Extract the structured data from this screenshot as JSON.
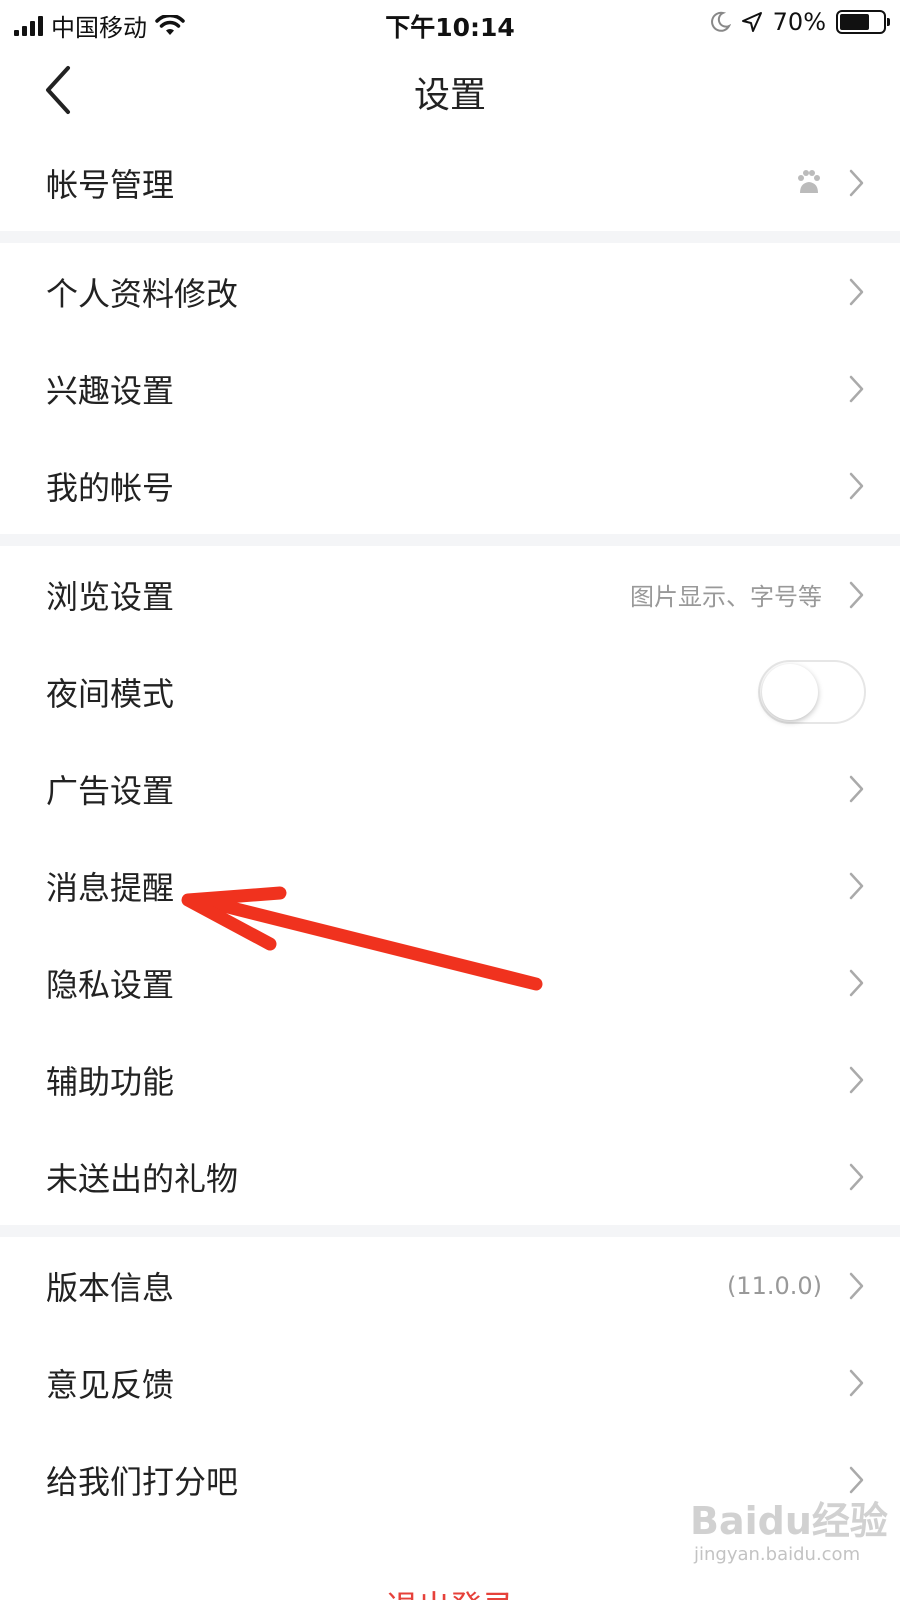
{
  "status_bar": {
    "carrier": "中国移动",
    "time": "下午10:14",
    "battery_text": "70%",
    "battery_level": 0.7
  },
  "nav": {
    "title": "设置",
    "back_icon": "chevron-left-icon"
  },
  "sections": [
    {
      "rows": [
        {
          "id": "account-manage",
          "label": "帐号管理",
          "badge_icon": "baidu-paw-icon"
        }
      ]
    },
    {
      "rows": [
        {
          "id": "profile-edit",
          "label": "个人资料修改"
        },
        {
          "id": "interest",
          "label": "兴趣设置"
        },
        {
          "id": "my-account",
          "label": "我的帐号"
        }
      ]
    },
    {
      "rows": [
        {
          "id": "browse",
          "label": "浏览设置",
          "hint": "图片显示、字号等"
        },
        {
          "id": "night-mode",
          "label": "夜间模式",
          "toggle": false
        },
        {
          "id": "ad",
          "label": "广告设置"
        },
        {
          "id": "notification",
          "label": "消息提醒"
        },
        {
          "id": "privacy",
          "label": "隐私设置"
        },
        {
          "id": "accessibility",
          "label": "辅助功能"
        },
        {
          "id": "unsent-gifts",
          "label": "未送出的礼物"
        }
      ]
    },
    {
      "rows": [
        {
          "id": "version",
          "label": "版本信息",
          "hint": "(11.0.0)"
        },
        {
          "id": "feedback",
          "label": "意见反馈"
        },
        {
          "id": "rate-us",
          "label": "给我们打分吧"
        }
      ]
    }
  ],
  "logout_label": "退出登录",
  "annotation": {
    "color": "#f0321e"
  },
  "watermark": {
    "logo": "Baidu经验",
    "url": "jingyan.baidu.com"
  },
  "colors": {
    "accent_red": "#e6413a",
    "separator": "#f4f5f7",
    "hint_gray": "#999999"
  }
}
